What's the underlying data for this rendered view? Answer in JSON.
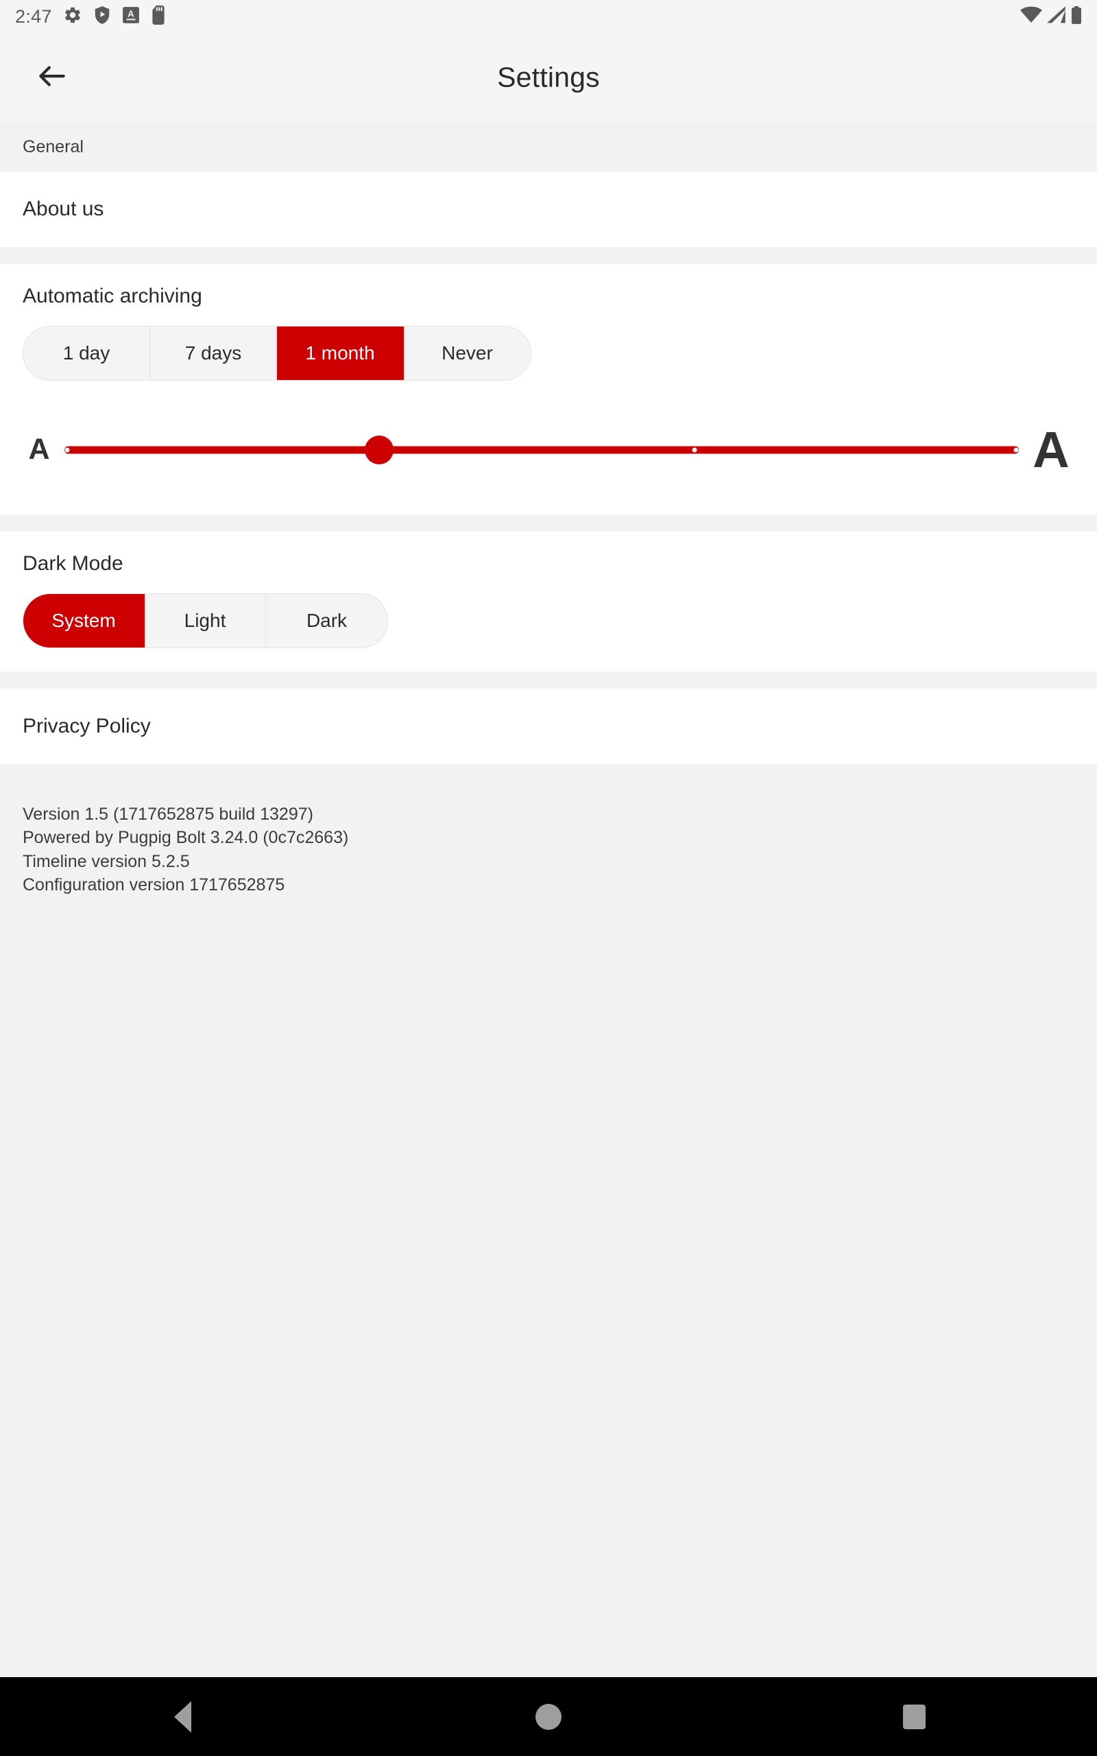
{
  "status_bar": {
    "time": "2:47",
    "left_icons": [
      "gear-icon",
      "shield-play-icon",
      "font-a-icon",
      "sd-card-icon"
    ],
    "right_icons": [
      "wifi-icon",
      "cellular-signal-icon",
      "battery-icon"
    ]
  },
  "app_bar": {
    "back_icon": "back-arrow-icon",
    "title": "Settings"
  },
  "sections": {
    "general_header": "General",
    "about_us": "About us",
    "privacy_policy": "Privacy Policy"
  },
  "automatic_archiving": {
    "title": "Automatic archiving",
    "options": [
      "1 day",
      "7 days",
      "1 month",
      "Never"
    ],
    "selected": "1 month",
    "selected_index": 2
  },
  "font_size_slider": {
    "small_label": "A",
    "large_label": "A",
    "value_percent": 33,
    "ticks_percent": [
      0,
      33,
      66,
      100
    ]
  },
  "dark_mode": {
    "title": "Dark Mode",
    "options": [
      "System",
      "Light",
      "Dark"
    ],
    "selected": "System",
    "selected_index": 0
  },
  "version_info": {
    "line1": "Version 1.5 (1717652875 build 13297)",
    "line2": "Powered by Pugpig Bolt 3.24.0 (0c7c2663)",
    "line3": "Timeline version 5.2.5",
    "line4": "Configuration version 1717652875"
  },
  "nav_bar": {
    "back": "nav-back-icon",
    "home": "nav-home-icon",
    "recents": "nav-recents-icon"
  },
  "colors": {
    "accent_red": "#cc0000",
    "page_bg": "#f2f2f2",
    "card_bg": "#ffffff",
    "nav_bg": "#000000"
  }
}
